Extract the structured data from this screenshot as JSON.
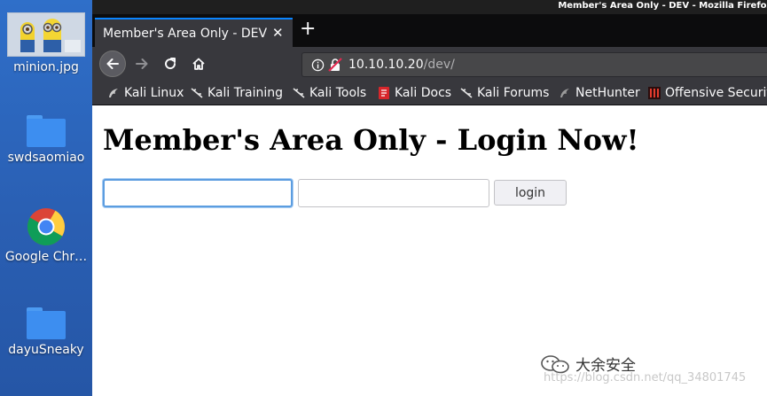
{
  "desktop": {
    "icons": [
      {
        "label": "minion.jpg",
        "icon": "image-thumbnail-icon"
      },
      {
        "label": "swdsaomiao",
        "icon": "folder-icon"
      },
      {
        "label": "Google Chr…",
        "icon": "chrome-icon"
      },
      {
        "label": "dayuSneaky",
        "icon": "folder-icon"
      }
    ]
  },
  "window": {
    "title": "Member's Area Only - DEV - Mozilla Firefox"
  },
  "tabs": {
    "active_title": "Member's Area Only - DEV",
    "close_glyph": "✕",
    "new_tab_glyph": "+"
  },
  "urlbar": {
    "host": "10.10.10.20",
    "path": "/dev/"
  },
  "bookmarks": [
    {
      "label": "Kali Linux",
      "icon": "kali-dragon-icon"
    },
    {
      "label": "Kali Training",
      "icon": "kali-dragon-icon"
    },
    {
      "label": "Kali Tools",
      "icon": "kali-dragon-icon"
    },
    {
      "label": "Kali Docs",
      "icon": "kali-docs-icon"
    },
    {
      "label": "Kali Forums",
      "icon": "kali-dragon-icon"
    },
    {
      "label": "NetHunter",
      "icon": "nethunter-icon"
    },
    {
      "label": "Offensive Security",
      "icon": "offsec-icon"
    }
  ],
  "page": {
    "heading": "Member's Area Only - Login Now!",
    "username_value": "",
    "password_value": "",
    "login_label": "login"
  },
  "watermark": {
    "name": "大余安全",
    "url": "https://blog.csdn.net/qq_34801745"
  },
  "colors": {
    "desktop_bg": "#2a63b8",
    "tab_accent": "#0a84ff",
    "toolbar": "#38383d",
    "tabstrip": "#0c0c0d",
    "focus_ring": "#5c9de0"
  }
}
